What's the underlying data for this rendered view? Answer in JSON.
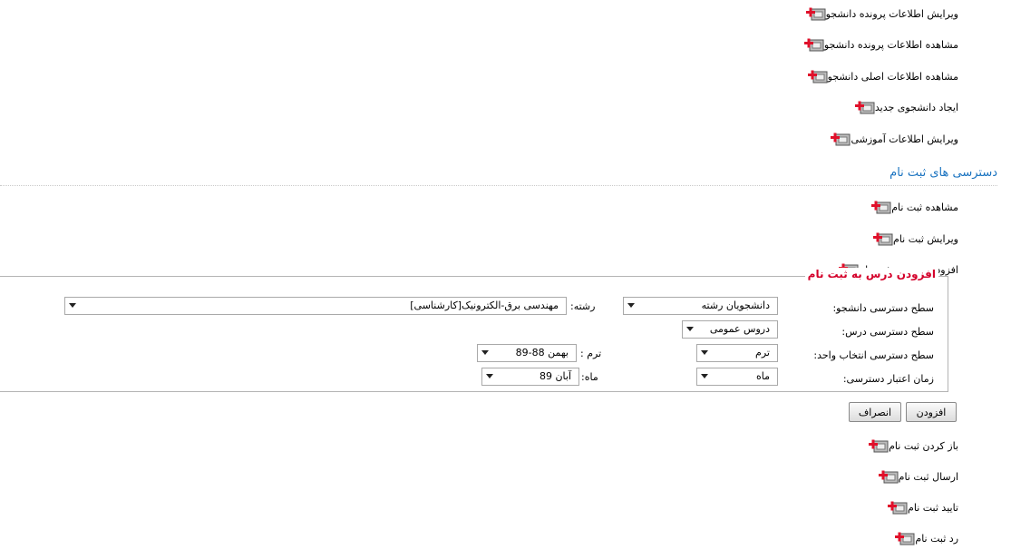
{
  "top_links": [
    {
      "label": "ویرایش اطلاعات پرونده دانشجو",
      "icon": "permission-key-icon"
    },
    {
      "label": "مشاهده اطلاعات پرونده دانشجو",
      "icon": "permission-key-icon"
    },
    {
      "label": "مشاهده اطلاعات اصلی دانشجو",
      "icon": "permission-key-icon"
    },
    {
      "label": "ایجاد دانشجوی جدید",
      "icon": "permission-key-icon"
    },
    {
      "label": "ویرایش اطلاعات آموزشی",
      "icon": "permission-key-icon"
    }
  ],
  "section_title": "دسترسی های ثبت نام",
  "registration_links": [
    {
      "label": "مشاهده ثبت نام",
      "icon": "permission-key-icon"
    },
    {
      "label": "ویرایش ثبت نام",
      "icon": "permission-key-icon"
    },
    {
      "label": "افزودن درس به ثبت نام",
      "icon": "permission-key-icon"
    }
  ],
  "panel": {
    "legend": "افزودن درس به ثبت نام",
    "student_level_label": "سطح دسترسی دانشجو:",
    "student_level_value": "دانشجویان رشته",
    "major_label": "رشته:",
    "major_value": "مهندسی برق-الکترونیک[کارشناسی]",
    "course_level_label": "سطح دسترسی درس:",
    "course_level_value": "دروس عمومی",
    "unit_level_label": "سطح دسترسی انتخاب واحد:",
    "unit_level_value": "ترم",
    "term_label": "ترم :",
    "term_value": "بهمن 88-89",
    "validity_label": "زمان اعتبار دسترسی:",
    "validity_value": "ماه",
    "month_label": "ماه:",
    "month_value": "آبان 89"
  },
  "buttons": {
    "add": "افزودن",
    "cancel": "انصراف"
  },
  "bottom_links": [
    {
      "label": "باز کردن ثبت نام",
      "icon": "permission-key-icon"
    },
    {
      "label": "ارسال ثبت نام",
      "icon": "permission-key-icon"
    },
    {
      "label": "تایید ثبت نام",
      "icon": "permission-key-icon"
    },
    {
      "label": "رد ثبت نام",
      "icon": "permission-key-icon"
    }
  ],
  "colors": {
    "section_title": "#1a73c0",
    "legend": "#d4002a",
    "icon_plus": "#e0102a"
  }
}
